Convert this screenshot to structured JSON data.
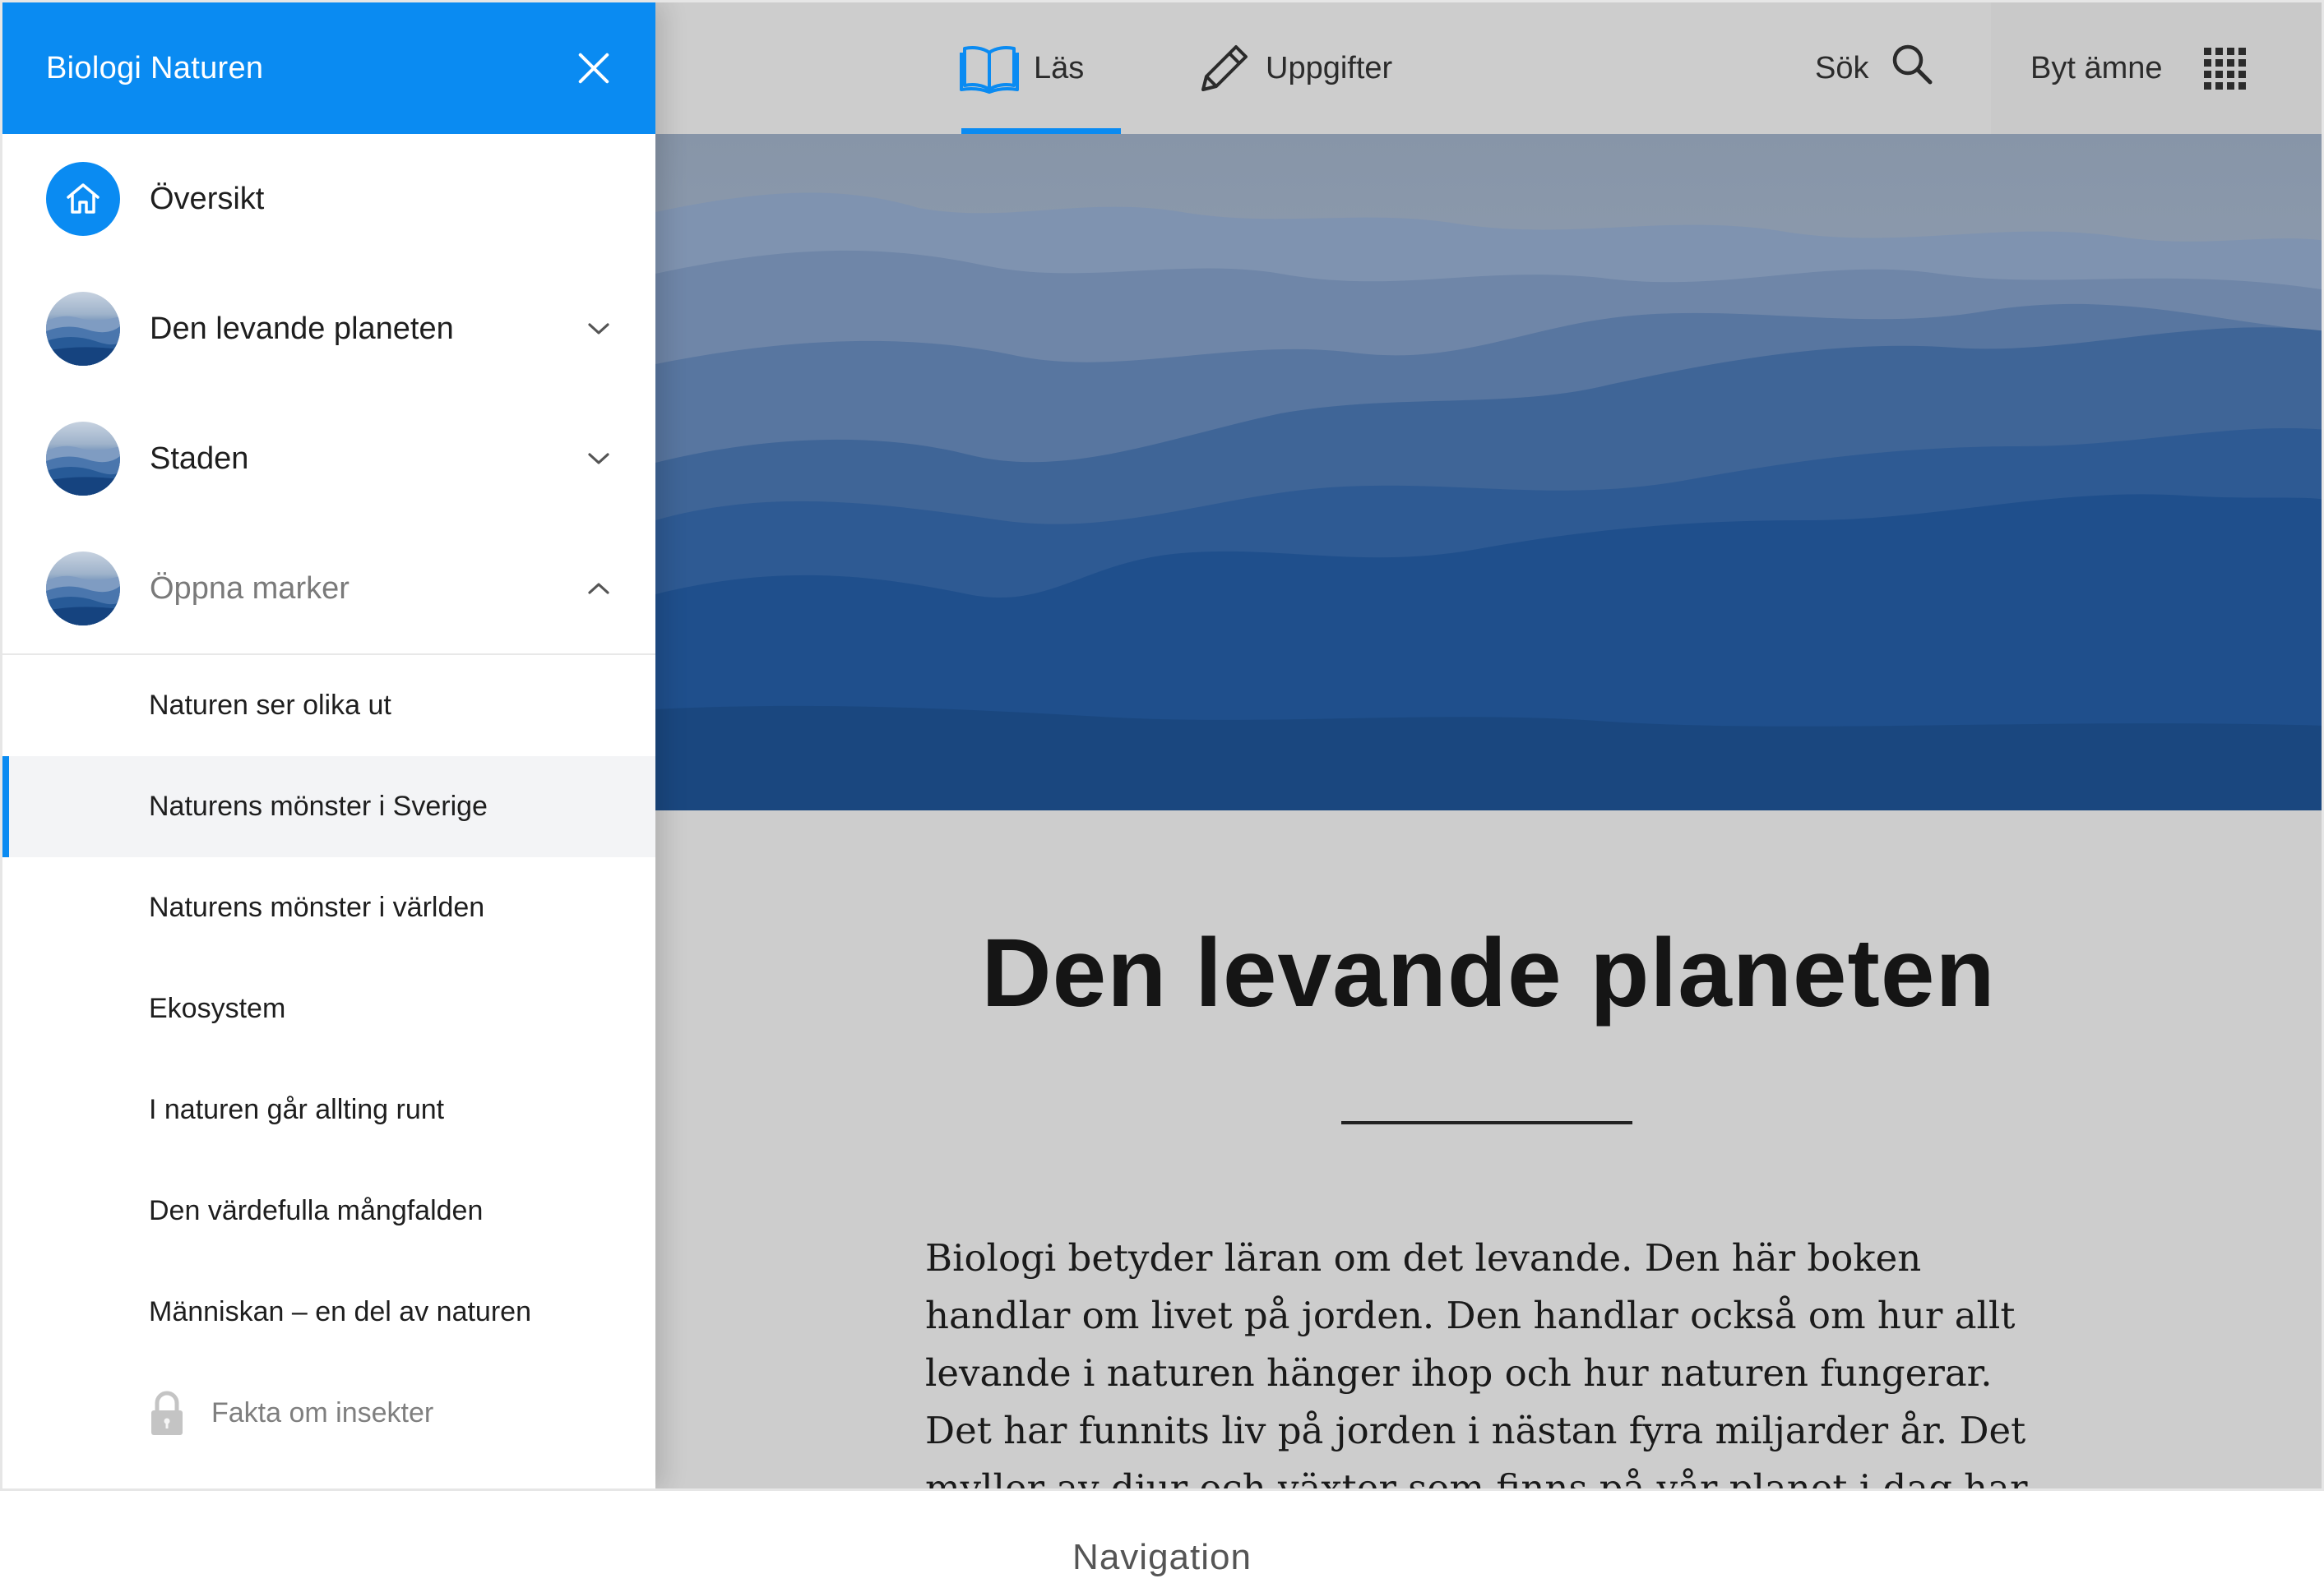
{
  "sidebar": {
    "title": "Biologi Naturen",
    "chapters": [
      {
        "label": "Översikt"
      },
      {
        "label": "Den levande planeten"
      },
      {
        "label": "Staden"
      },
      {
        "label": "Öppna marker"
      }
    ],
    "subitems": [
      {
        "label": "Naturen ser olika ut"
      },
      {
        "label": "Naturens mönster i Sverige"
      },
      {
        "label": "Naturens mönster i världen"
      },
      {
        "label": "Ekosystem"
      },
      {
        "label": "I naturen går allting runt"
      },
      {
        "label": "Den värdefulla mångfalden"
      },
      {
        "label": "Människan – en del av naturen"
      },
      {
        "label": "Fakta om insekter"
      }
    ]
  },
  "topbar": {
    "read_label": "Läs",
    "tasks_label": "Uppgifter",
    "search_label": "Sök",
    "switch_label": "Byt ämne"
  },
  "article": {
    "title": "Den levande planeten",
    "body": "Biologi betyder läran om det levande. Den här boken handlar om livet på jorden. Den handlar också om hur allt levande i naturen hänger ihop och hur naturen fungerar. Det har funnits liv på jorden i nästan fyra miljarder år. Det myller av djur och växter som finns på vår planet i dag har utvecklats ur de första enkla"
  },
  "caption": "Navigation",
  "colors": {
    "accent": "#0a8bf2",
    "page_bg": "#cdcdcd",
    "active_row_bg": "#f3f4f6"
  },
  "icons": [
    "close-icon",
    "home-icon",
    "chevron-down-icon",
    "chevron-up-icon",
    "lock-icon",
    "book-icon",
    "pencil-icon",
    "search-icon",
    "grid-icon"
  ]
}
